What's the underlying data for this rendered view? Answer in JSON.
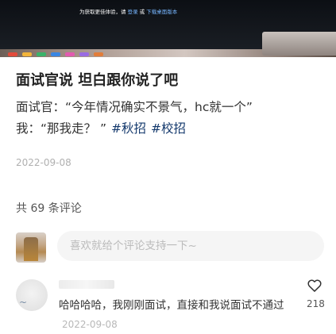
{
  "banner": {
    "notice_prefix": "为获取更佳体验，请",
    "login_link": "登录",
    "connector": "或",
    "download_link": "下载桌面版本"
  },
  "post": {
    "title": "面试官说 坦白跟你说了吧",
    "body_line1": "面试官：“今年情况确实不景气，hc就一个”",
    "body_line2": "我：“那我走？ ”",
    "tags": [
      "#秋招",
      "#校招"
    ],
    "date": "2022-09-08"
  },
  "comments_section": {
    "count_label": "共 69 条评论",
    "input_placeholder": "喜欢就给个评论支持一下~"
  },
  "comment": {
    "text": "哈哈哈哈，我刚刚面试，直接和我说面试不通过",
    "date": "2022-09-08",
    "likes": "218",
    "like_icon": "heart-outline-icon"
  },
  "colors": {
    "tag": "#13386c",
    "link": "#77b6ff",
    "input_bg": "#f5f5f5"
  }
}
